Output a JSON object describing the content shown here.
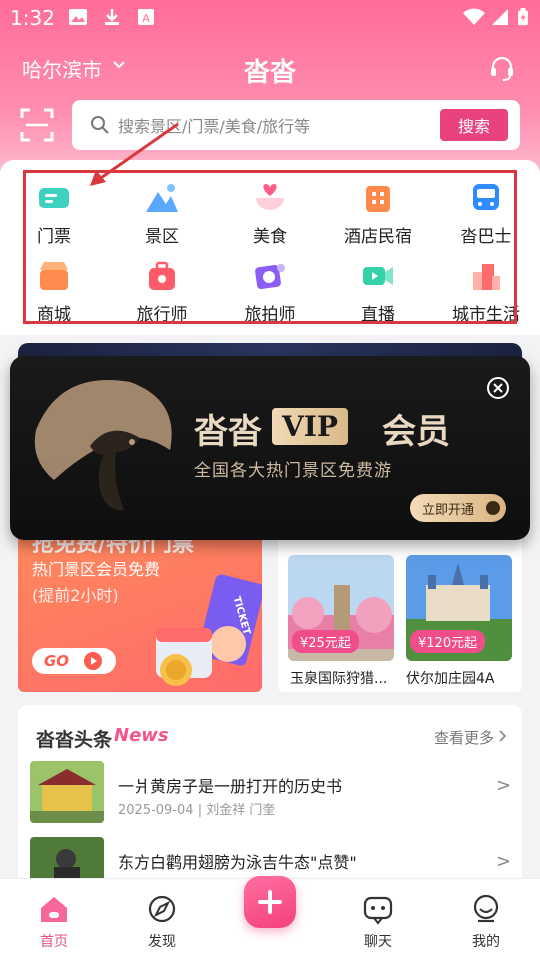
{
  "status_bar": {
    "time": "1:32"
  },
  "header": {
    "city": "哈尔滨市",
    "app_title": "沓沓",
    "search_placeholder": "搜索景区/门票/美食/旅行等",
    "search_button": "搜索"
  },
  "categories": [
    {
      "label": "门票",
      "icon": "ticket-icon",
      "color": "#3fd1c0"
    },
    {
      "label": "景区",
      "icon": "mountain-icon",
      "color": "#5aa8ff"
    },
    {
      "label": "美食",
      "icon": "food-bowl-icon",
      "color": "#ff5f86"
    },
    {
      "label": "酒店民宿",
      "icon": "hotel-icon",
      "color": "#ff8a4c"
    },
    {
      "label": "沓巴士",
      "icon": "bus-icon",
      "color": "#2f8cff"
    },
    {
      "label": "商城",
      "icon": "shop-icon",
      "color": "#ff8c4a"
    },
    {
      "label": "旅行师",
      "icon": "travel-bag-icon",
      "color": "#ff5a6a"
    },
    {
      "label": "旅拍师",
      "icon": "camera-icon",
      "color": "#8b5cf6"
    },
    {
      "label": "直播",
      "icon": "video-icon",
      "color": "#34d2a8"
    },
    {
      "label": "城市生活",
      "icon": "city-icon",
      "color": "#ff6b6b"
    }
  ],
  "promo": {
    "headline": "抢免费/特价门票",
    "line1": "热门景区会员免费",
    "line2": "(提前2小时)",
    "go_label": "GO",
    "ticket_word": "TICKET"
  },
  "tickets": [
    {
      "name": "玉泉国际狩猎...",
      "price": "¥25元起"
    },
    {
      "name": "伏尔加庄园4A",
      "price": "¥120元起"
    }
  ],
  "news": {
    "brand": "沓沓头条",
    "brand_en": "News",
    "more": "查看更多",
    "items": [
      {
        "title": "一爿黄房子是一册打开的历史书",
        "date": "2025-09-04",
        "author": "刘金祥 门奎"
      },
      {
        "title": "东方白鹳用翅膀为泳吉牛态\"点赞\""
      }
    ]
  },
  "vip_popup": {
    "brand": "沓沓",
    "vip": "VIP",
    "member": "会员",
    "subtitle": "全国各大热门景区免费游",
    "open_button": "立即开通"
  },
  "tabs": [
    {
      "label": "首页",
      "active": true
    },
    {
      "label": "发现",
      "active": false
    },
    {
      "label": "聊天",
      "active": false
    },
    {
      "label": "我的",
      "active": false
    }
  ],
  "colors": {
    "brand_pink": "#ff6c98",
    "accent": "#e9437f",
    "highlight_box": "#d9383e"
  }
}
